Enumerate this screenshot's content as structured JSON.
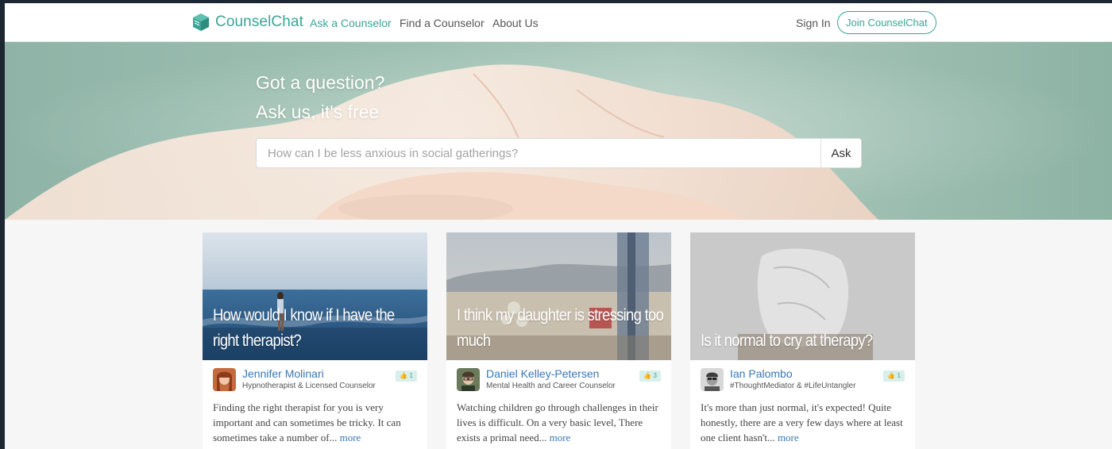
{
  "nav": {
    "brand": "CounselChat",
    "links": [
      {
        "label": "Ask a Counselor",
        "active": true
      },
      {
        "label": "Find a Counselor",
        "active": false
      },
      {
        "label": "About Us",
        "active": false
      }
    ],
    "sign_in": "Sign In",
    "join": "Join CounselChat"
  },
  "hero": {
    "line1": "Got a question?",
    "line2": "Ask us, it's free",
    "search_placeholder": "How can I be less anxious in social gatherings?",
    "ask_button": "Ask"
  },
  "cards": [
    {
      "title": "How would I know if I have the right therapist?",
      "author": "Jennifer Molinari",
      "role": "Hypnotherapist & Licensed Counselor",
      "likes": "1",
      "excerpt": "Finding the right therapist for you is very important and can sometimes be tricky. It can sometimes take a number of...",
      "more": "more"
    },
    {
      "title": "I think my daughter is stressing too much",
      "author": "Daniel Kelley-Petersen",
      "role": "Mental Health and Career Counselor",
      "likes": "3",
      "excerpt": "Watching children go through challenges in their lives is difficult. On a very basic level, There exists a primal need...",
      "more": "more"
    },
    {
      "title": "Is it normal to cry at therapy?",
      "author": "Ian Palombo",
      "role": "#ThoughtMediator & #LifeUntangler",
      "likes": "1",
      "excerpt": "It's more than just normal, it's expected! Quite honestly, there are a very few days where at least one client hasn't...",
      "more": "more"
    }
  ],
  "colors": {
    "brand": "#3aa596",
    "link": "#3878b5",
    "like_bg": "#d8efec"
  },
  "icons": {
    "logo": "book-cube-icon",
    "like": "thumbs-up-icon"
  }
}
